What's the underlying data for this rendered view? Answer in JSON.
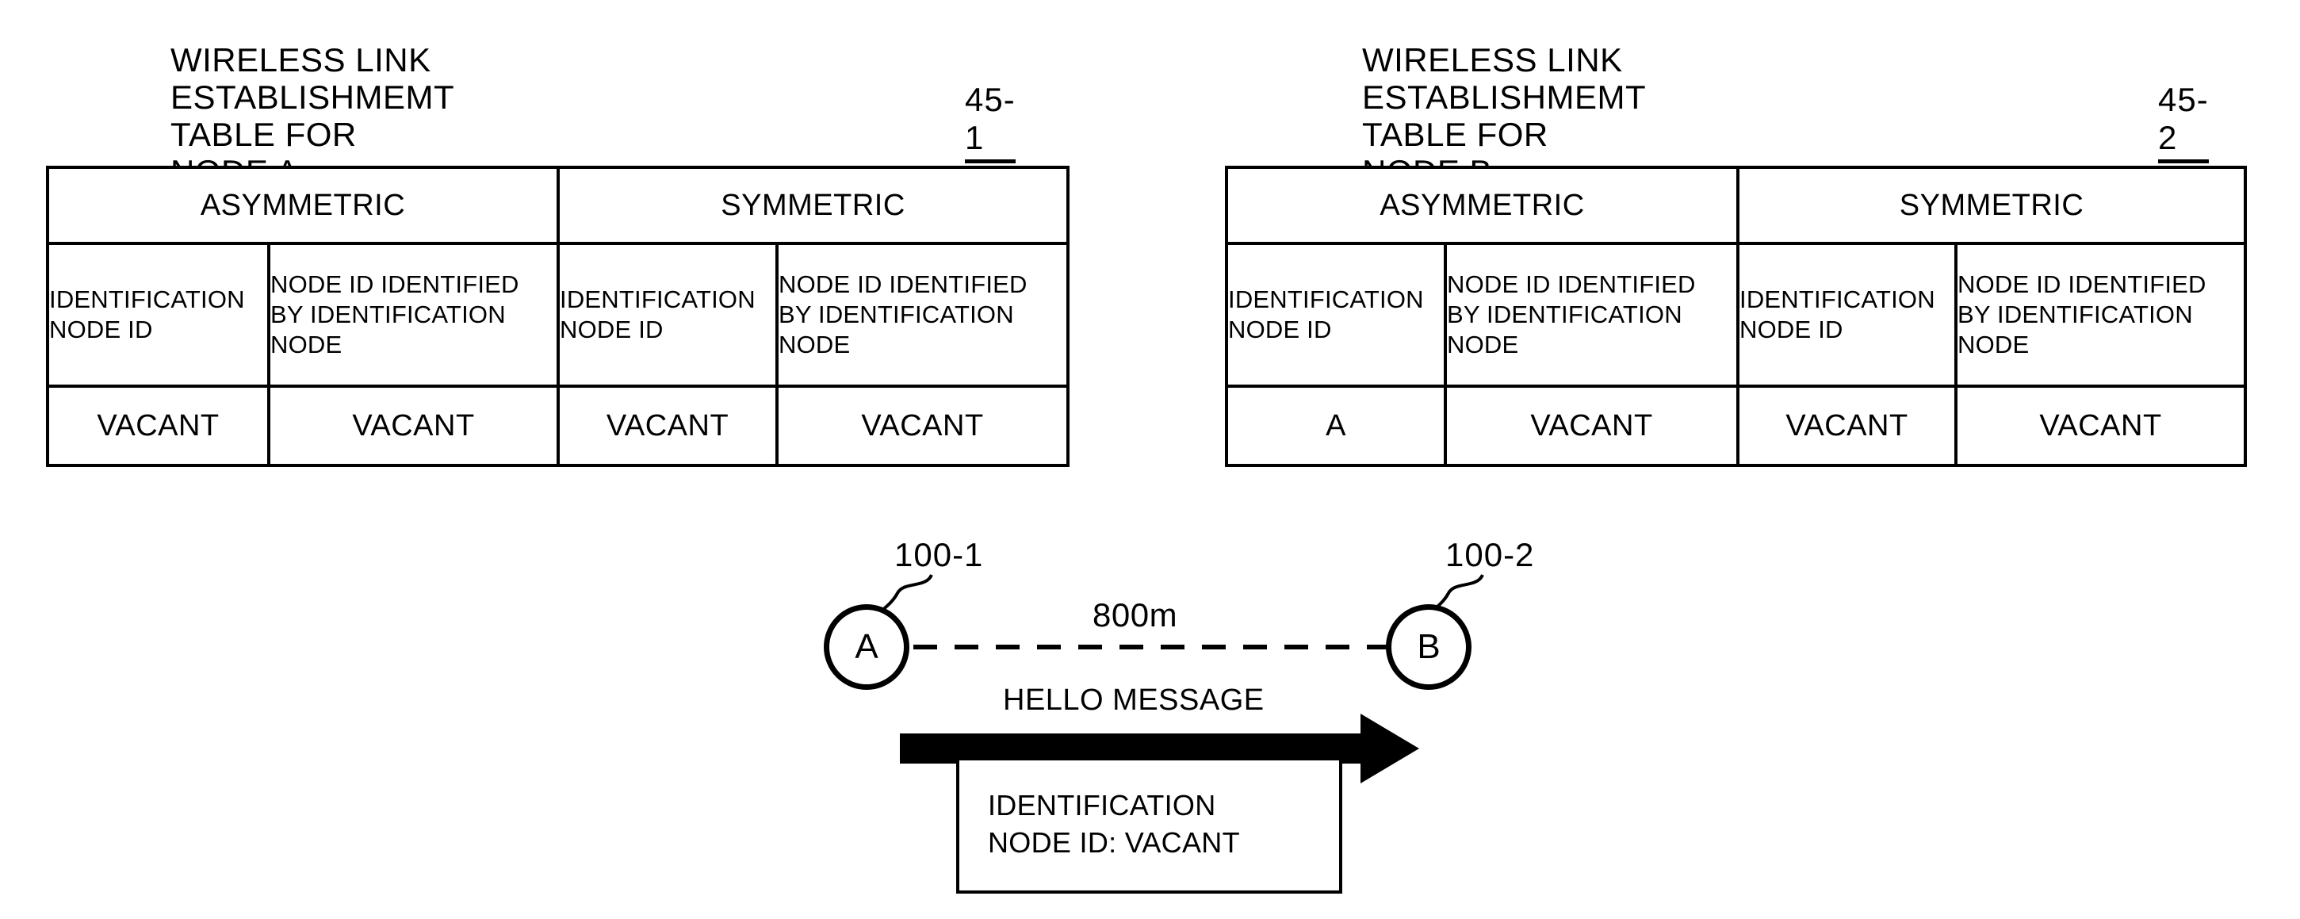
{
  "figure": {
    "tables": [
      {
        "title": "WIRELESS LINK ESTABLISHMEMT\nTABLE FOR NODE A",
        "ref": "45-1",
        "group_headers": [
          "ASYMMETRIC",
          "SYMMETRIC"
        ],
        "sub_headers": [
          "IDENTIFICATION\nNODE ID",
          "NODE ID IDENTIFIED\nBY IDENTIFICATION\nNODE",
          "IDENTIFICATION\nNODE ID",
          "NODE ID IDENTIFIED\nBY IDENTIFICATION\nNODE"
        ],
        "values": [
          "VACANT",
          "VACANT",
          "VACANT",
          "VACANT"
        ]
      },
      {
        "title": "WIRELESS LINK ESTABLISHMEMT\nTABLE FOR NODE B",
        "ref": "45-2",
        "group_headers": [
          "ASYMMETRIC",
          "SYMMETRIC"
        ],
        "sub_headers": [
          "IDENTIFICATION\nNODE ID",
          "NODE ID IDENTIFIED\nBY IDENTIFICATION\nNODE",
          "IDENTIFICATION\nNODE ID",
          "NODE ID IDENTIFIED\nBY IDENTIFICATION\nNODE"
        ],
        "values": [
          "A",
          "VACANT",
          "VACANT",
          "VACANT"
        ]
      }
    ],
    "network": {
      "node_a_label": "A",
      "node_a_ref": "100-1",
      "node_b_label": "B",
      "node_b_ref": "100-2",
      "distance_label": "800m",
      "message_label": "HELLO MESSAGE",
      "payload_text": "IDENTIFICATION\nNODE ID: VACANT"
    }
  },
  "colors": {
    "ink": "#000000",
    "paper": "#ffffff"
  }
}
